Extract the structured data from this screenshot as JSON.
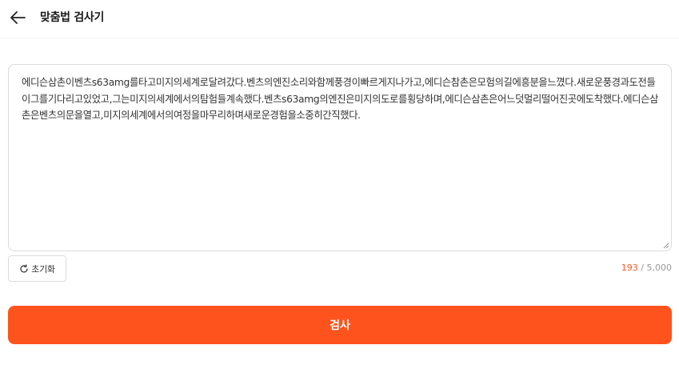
{
  "header": {
    "title": "맞춤법 검사기",
    "back_icon": "arrow-left-icon"
  },
  "editor": {
    "text": "에디슨삼촌이벤츠s63amg를타고미지의세계로달려갔다.벤츠의엔진소리와함께풍경이빠르게지나가고,에디슨참촌은모험의길에흥분을느꼈다.새로운풍경과도전들이그를기다리고있었고,그는미지의세계에서의탐험들계속했다.벤츠s63amg의엔진은미지의도로를횡당하며,에디슨삼촌은어느덧멀리떨어진곳에도착했다.에디슨삼촌은벤츠의문을열고,미지의세계에서의여정을마무리하며새로운경험을소중히간직했다."
  },
  "controls": {
    "reset_label": "초기화",
    "reset_icon": "refresh-icon",
    "char_count": "193",
    "char_separator": " / ",
    "char_limit": "5,000"
  },
  "submit": {
    "label": "검사"
  },
  "colors": {
    "accent": "#ff531d",
    "count": "#ff5a2a",
    "border": "#dcdcdc"
  }
}
